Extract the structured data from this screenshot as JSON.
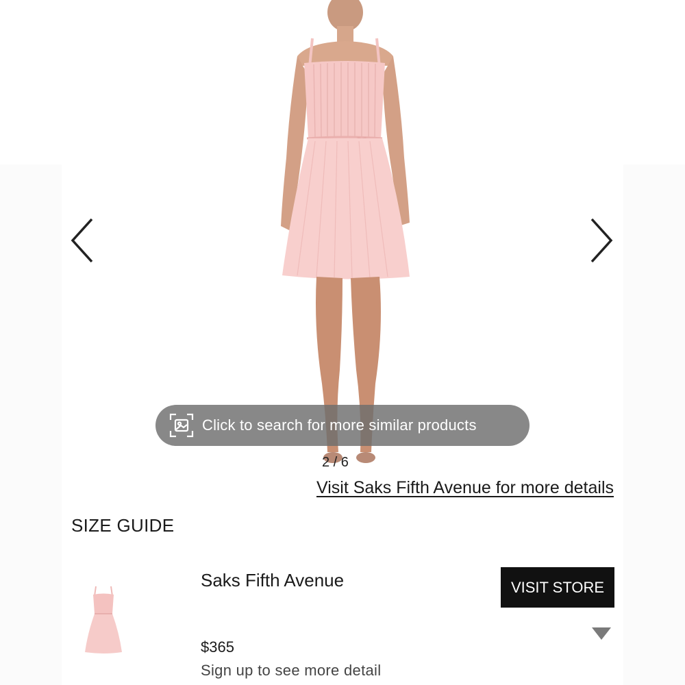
{
  "gallery": {
    "counter": "2 / 6",
    "image_subject": "pink pleated sleeveless mini dress on model",
    "prev_icon": "chevron-left-icon",
    "next_icon": "chevron-right-icon"
  },
  "visual_search": {
    "label": "Click to search for more similar products",
    "icon": "image-search-icon"
  },
  "details_link": "Visit Saks Fifth Avenue for more details",
  "size_guide": "SIZE GUIDE",
  "offer": {
    "store": "Saks Fifth Avenue",
    "button": "VISIT STORE",
    "price": "$365",
    "note": "Sign up to see more detail",
    "expand_icon": "caret-down-icon"
  },
  "colors": {
    "dress": "#f6c8c6",
    "button_bg": "#111111",
    "pill_bg": "#6e6e6e"
  }
}
